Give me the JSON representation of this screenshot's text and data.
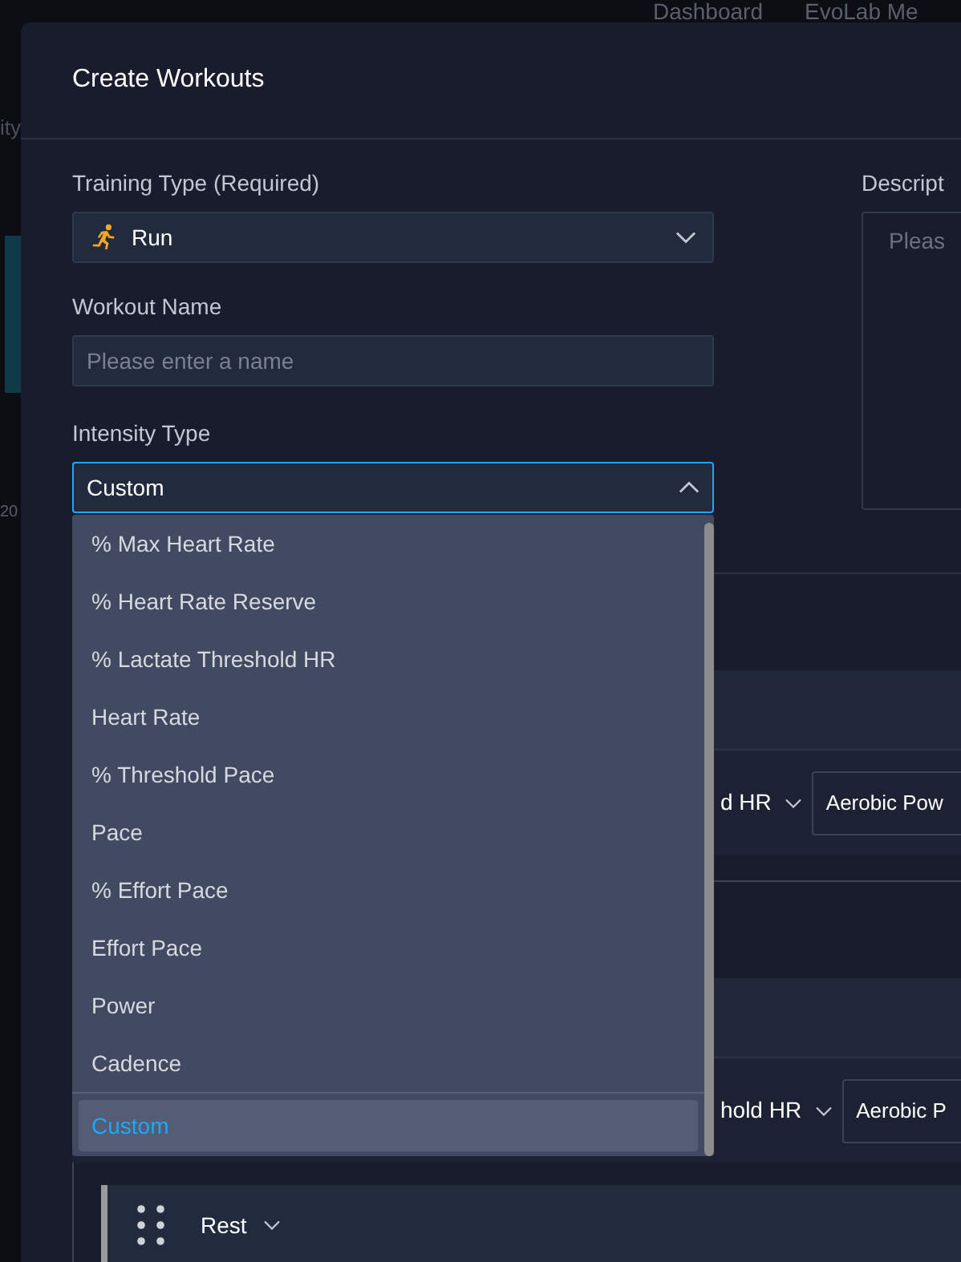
{
  "background_page": {
    "nav": [
      "Dashboard",
      "EvoLab Me"
    ],
    "fragments": [
      "ity",
      "20"
    ]
  },
  "dialog": {
    "title": "Create Workouts",
    "training_type": {
      "label": "Training Type (Required)",
      "value": "Run"
    },
    "workout_name": {
      "label": "Workout Name",
      "placeholder": "Please enter a name"
    },
    "intensity_type": {
      "label": "Intensity Type",
      "value": "Custom",
      "expanded": true,
      "options": [
        {
          "label": "% Max Heart Rate",
          "selected": false
        },
        {
          "label": "% Heart Rate Reserve",
          "selected": false
        },
        {
          "label": "% Lactate Threshold HR",
          "selected": false
        },
        {
          "label": "Heart Rate",
          "selected": false
        },
        {
          "label": "% Threshold Pace",
          "selected": false
        },
        {
          "label": "Pace",
          "selected": false
        },
        {
          "label": "% Effort Pace",
          "selected": false
        },
        {
          "label": "Effort Pace",
          "selected": false
        },
        {
          "label": "Power",
          "selected": false
        },
        {
          "label": "Cadence",
          "selected": false
        },
        {
          "label": "Custom",
          "selected": true
        }
      ]
    },
    "description": {
      "label": "Descript",
      "placeholder": "Pleas"
    },
    "steps": [
      {
        "intensity": "d HR",
        "zone": "Aerobic Pow"
      },
      {
        "intensity": "hold HR",
        "zone": "Aerobic P"
      }
    ],
    "rest_step": {
      "label": "Rest"
    }
  }
}
